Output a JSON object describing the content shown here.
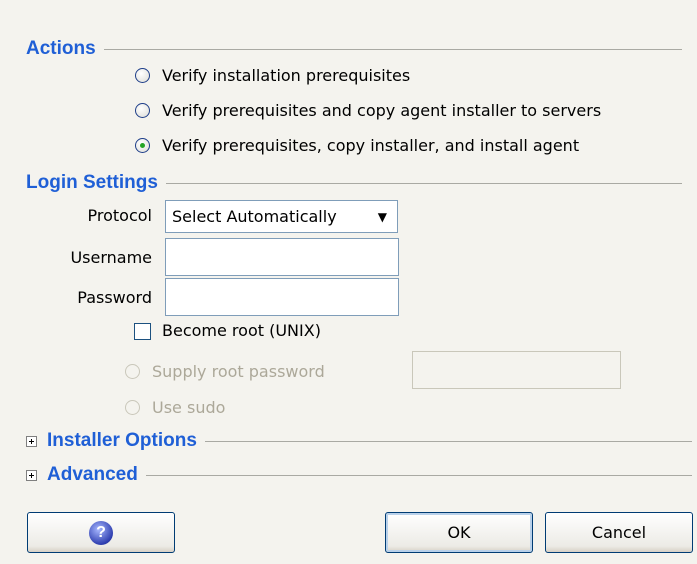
{
  "actions": {
    "title": "Actions",
    "options": [
      {
        "label": "Verify installation prerequisites",
        "checked": false
      },
      {
        "label": "Verify prerequisites and copy agent installer to servers",
        "checked": false
      },
      {
        "label": "Verify prerequisites, copy installer, and install agent",
        "checked": true
      }
    ]
  },
  "login": {
    "title": "Login Settings",
    "protocol_label": "Protocol",
    "protocol_value": "Select Automatically",
    "username_label": "Username",
    "username_value": "",
    "password_label": "Password",
    "password_value": "",
    "become_root_label": "Become root (UNIX)",
    "become_root_checked": false,
    "supply_root_password_label": "Supply root password",
    "root_password_value": "",
    "use_sudo_label": "Use sudo"
  },
  "installer_options": {
    "title": "Installer Options",
    "expanded": false
  },
  "advanced": {
    "title": "Advanced",
    "expanded": false
  },
  "buttons": {
    "help_icon": "question-mark",
    "ok_label": "OK",
    "cancel_label": "Cancel"
  },
  "colors": {
    "section_title": "#1f5fd6",
    "background": "#f4f3ee",
    "radio_selected_dot": "#23a423",
    "disabled_text": "#aca899"
  }
}
